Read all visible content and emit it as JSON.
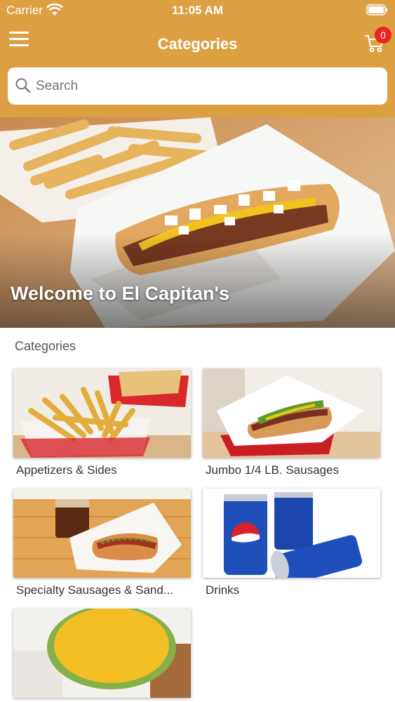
{
  "status_bar": {
    "carrier": "Carrier",
    "time": "11:05 AM"
  },
  "nav": {
    "title": "Categories",
    "cart_count": "0"
  },
  "search": {
    "placeholder": "Search"
  },
  "hero": {
    "title": "Welcome to El Capitan's"
  },
  "section": {
    "title": "Categories"
  },
  "categories": [
    {
      "label": "Appetizers & Sides"
    },
    {
      "label": "Jumbo 1/4 LB. Sausages"
    },
    {
      "label": "Specialty Sausages & Sand..."
    },
    {
      "label": "Drinks"
    },
    {
      "label": ""
    }
  ],
  "colors": {
    "brand": "#dca043",
    "badge": "#e8261f"
  },
  "icons": [
    "wifi-icon",
    "battery-icon",
    "menu-icon",
    "cart-icon",
    "search-icon"
  ]
}
